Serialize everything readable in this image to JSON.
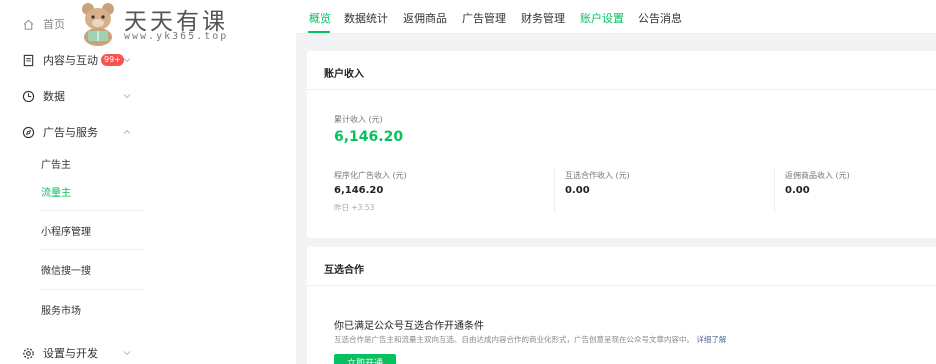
{
  "sidebar": {
    "home": "首页",
    "content": "内容与互动",
    "content_badge": "99+",
    "data": "数据",
    "ads": "广告与服务",
    "sub_items": [
      "广告主",
      "流量主",
      "小程序管理",
      "微信搜一搜",
      "服务市场"
    ],
    "dev": "设置与开发"
  },
  "watermark": {
    "title": "天天有课",
    "url": "www.yk365.top"
  },
  "tabs": [
    "概览",
    "数据统计",
    "返佣商品",
    "广告管理",
    "财务管理",
    "账户设置",
    "公告消息"
  ],
  "income": {
    "title": "账户收入",
    "total_label": "累计收入 (元)",
    "total_value": "6,146.20",
    "program_label": "程序化广告收入 (元)",
    "program_value": "6,146.20",
    "program_yesterday": "昨日 +3.53",
    "mutual_label": "互选合作收入 (元)",
    "mutual_value": "0.00",
    "rebate_label": "返佣商品收入 (元)",
    "rebate_value": "0.00"
  },
  "coop": {
    "title": "互选合作",
    "heading": "你已满足公众号互选合作开通条件",
    "desc": "互选合作是广告主和流量主双向互选、自由达成内容合作的商业化形式，广告创意呈现在公众号文章内容中。",
    "link": "详细了解",
    "button": "立即开通"
  },
  "colors": {
    "accent": "#07c160",
    "badge": "#fa5151",
    "link": "#576b95"
  },
  "icons": [
    "home-icon",
    "document-icon",
    "clock-icon",
    "compass-icon",
    "gear-icon",
    "chevron-down-icon",
    "chevron-up-icon"
  ]
}
